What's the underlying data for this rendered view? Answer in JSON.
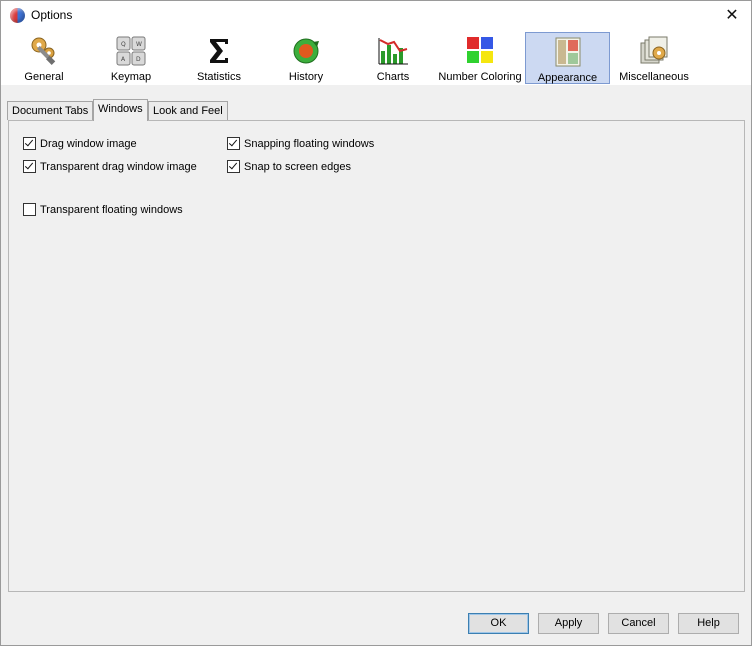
{
  "window": {
    "title": "Options"
  },
  "toolbar": {
    "items": [
      {
        "label": "General",
        "icon": "gears-wrench-icon"
      },
      {
        "label": "Keymap",
        "icon": "keyboard-keys-icon"
      },
      {
        "label": "Statistics",
        "icon": "sigma-icon"
      },
      {
        "label": "History",
        "icon": "history-refresh-icon"
      },
      {
        "label": "Charts",
        "icon": "bar-chart-icon"
      },
      {
        "label": "Number Coloring",
        "icon": "color-squares-icon"
      },
      {
        "label": "Appearance",
        "icon": "window-layout-icon"
      },
      {
        "label": "Miscellaneous",
        "icon": "misc-cards-gear-icon"
      }
    ],
    "selected": "Appearance"
  },
  "subtabs": {
    "items": [
      "Document Tabs",
      "Windows",
      "Look and Feel"
    ],
    "active": "Windows"
  },
  "options": {
    "drag_window_image": {
      "label": "Drag window image",
      "checked": true
    },
    "transparent_drag_window_image": {
      "label": "Transparent drag window image",
      "checked": true
    },
    "snapping_floating_windows": {
      "label": "Snapping floating windows",
      "checked": true
    },
    "snap_to_screen_edges": {
      "label": "Snap to screen edges",
      "checked": true
    },
    "transparent_floating_windows": {
      "label": "Transparent floating windows",
      "checked": false
    }
  },
  "buttons": {
    "ok": "OK",
    "apply": "Apply",
    "cancel": "Cancel",
    "help": "Help"
  }
}
